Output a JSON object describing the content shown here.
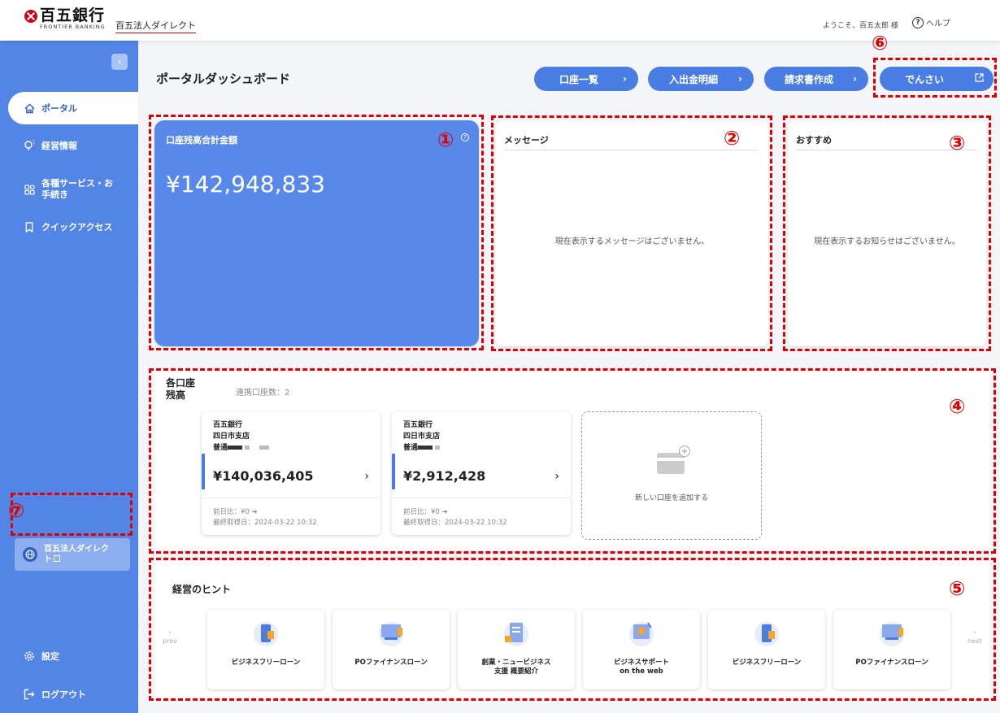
{
  "header": {
    "bank_name": "百五銀行",
    "bank_sub": "FRONTIER BANKING",
    "service_name": "百五法人ダイレクト",
    "welcome": "ようこそ、百五太郎 様",
    "help": "ヘルプ"
  },
  "sidebar": {
    "collapse": "‹",
    "items": [
      {
        "label": "ポータル",
        "icon": "home-icon"
      },
      {
        "label": "経営情報",
        "icon": "lightbulb-icon"
      },
      {
        "label": "各種サービス・お",
        "label2": "手続き",
        "icon": "grid-icon"
      },
      {
        "label": "クイックアクセス",
        "icon": "bookmark-icon"
      }
    ],
    "external_link": {
      "label": "百五法人ダイレク",
      "label2": "ト",
      "icon": "globe-icon"
    },
    "settings": "設定",
    "logout": "ログアウト"
  },
  "main": {
    "title": "ポータルダッシュボード",
    "buttons": [
      "口座一覧",
      "入出金明細",
      "請求書作成",
      "でんさい"
    ],
    "balance": {
      "label": "口座残高合計金額",
      "amount": "¥142,948,833"
    },
    "messages": {
      "title": "メッセージ",
      "empty": "現在表示するメッセージはございません。"
    },
    "recommend": {
      "title": "おすすめ",
      "empty": "現在表示するお知らせはございません。"
    },
    "accounts": {
      "title": "各口座残高",
      "count_label": "連携口座数：2",
      "list": [
        {
          "bank": "百五銀行",
          "branch": "四日市支店",
          "type": "普通",
          "amount": "¥140,036,405",
          "diff": "前日比：¥0 ➜",
          "updated": "最終取得日：2024-03-22 10:32"
        },
        {
          "bank": "百五銀行",
          "branch": "四日市支店",
          "type": "普通",
          "amount": "¥2,912,428",
          "diff": "前日比：¥0 ➜",
          "updated": "最終取得日：2024-03-22 10:32"
        }
      ],
      "add_label": "新しい口座を追加する"
    },
    "hints": {
      "title": "経営のヒント",
      "prev": "prev",
      "next": "next",
      "items": [
        {
          "label": "ビジネスフリーローン",
          "label2": ""
        },
        {
          "label": "POファイナンスローン",
          "label2": ""
        },
        {
          "label": "創業・ニュービジネス",
          "label2": "支援 概要紹介"
        },
        {
          "label": "ビジネスサポート",
          "label2": "on the web"
        },
        {
          "label": "ビジネスフリーローン",
          "label2": ""
        },
        {
          "label": "POファイナンスローン",
          "label2": ""
        }
      ]
    }
  },
  "annotations": [
    "①",
    "②",
    "③",
    "④",
    "⑤",
    "⑥",
    "⑦"
  ],
  "colors": {
    "sidebar": "#5285e6",
    "accent": "#4a7de3",
    "annotation": "#e00000"
  }
}
